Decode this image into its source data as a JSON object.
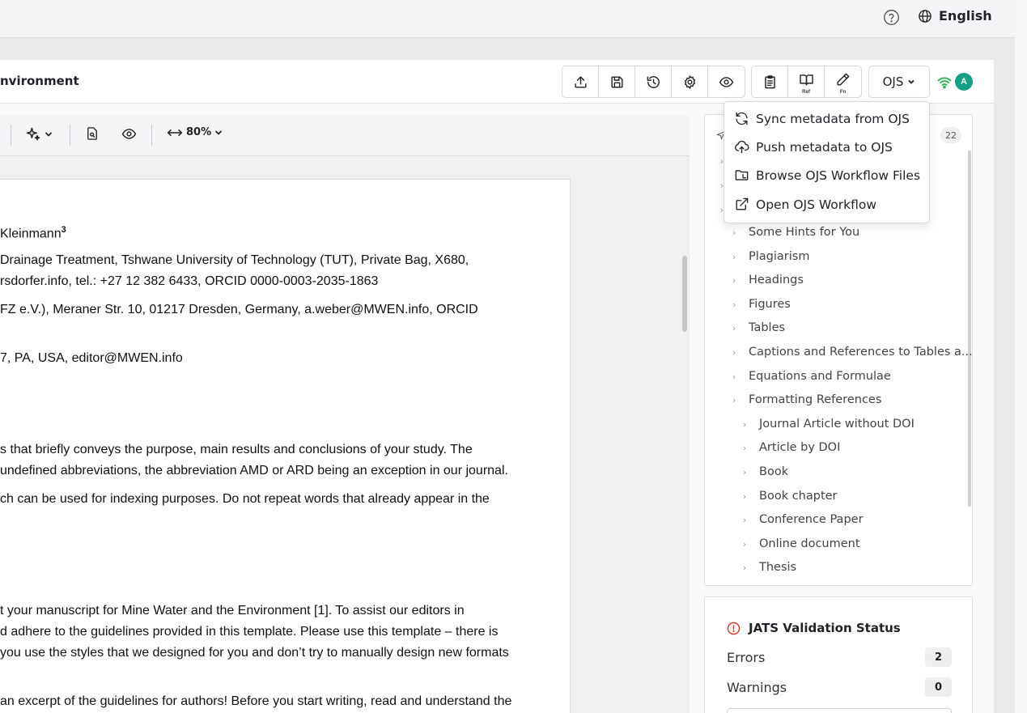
{
  "topbar": {
    "help_icon": "question-circle-icon",
    "language": "English"
  },
  "header": {
    "doc_title": "nvironment",
    "toolbar_groups": [
      [
        "upload-icon",
        "save-icon",
        "history-icon",
        "settings-icon",
        "preview-eye-icon"
      ],
      [
        "clipboard-icon",
        "references-book-icon",
        "footnote-pen-icon"
      ]
    ],
    "ref_label": "Ref",
    "fn_label": "Fn",
    "ojs_label": "OJS",
    "avatar_initial": "A",
    "accent_color": "#14a085"
  },
  "editor_toolbar": {
    "zoom": "80%"
  },
  "document": {
    "lines": [
      "Kleinmann",
      "Drainage Treatment, Tshwane University of Technology (TUT), Private Bag, X680,",
      "rsdorfer.info, tel.: +27 12 382 6433, ORCID 0000-0003-2035-1863",
      "FZ e.V.), Meraner Str. 10, 01217 Dresden, Germany, a.weber@MWEN.info, ORCID",
      "7, PA, USA, editor@MWEN.info",
      "s that briefly conveys the purpose, main results and conclusions of your study. The",
      "undefined abbreviations, the abbreviation AMD or ARD being an exception in our journal.",
      "ch can be used for indexing purposes. Do not repeat words that already appear in the",
      "t your manuscript for Mine Water and the Environment [1]. To assist our editors in",
      "d adhere to the guidelines provided in this template. Please use this template – there is",
      "you use the styles that we designed for you and don’t try to manually design new formats",
      "an excerpt of the guidelines for authors! Before you start writing, read and understand the"
    ],
    "superscript": "3"
  },
  "ojs_menu": {
    "items": [
      {
        "label": "Sync metadata from OJS",
        "icon": "sync-icon"
      },
      {
        "label": "Push metadata to OJS",
        "icon": "cloud-upload-icon"
      },
      {
        "label": "Browse OJS Workflow Files",
        "icon": "folder-icon"
      },
      {
        "label": "Open OJS Workflow",
        "icon": "external-link-icon"
      }
    ]
  },
  "outline": {
    "count": "22",
    "items": [
      {
        "label": "Some Hints for You",
        "level": 1
      },
      {
        "label": "Plagiarism",
        "level": 1
      },
      {
        "label": "Headings",
        "level": 1
      },
      {
        "label": "Figures",
        "level": 1
      },
      {
        "label": "Tables",
        "level": 1
      },
      {
        "label": "Captions and References to Tables a...",
        "level": 1
      },
      {
        "label": "Equations and Formulae",
        "level": 1
      },
      {
        "label": "Formatting References",
        "level": 1
      },
      {
        "label": "Journal Article without DOI",
        "level": 2
      },
      {
        "label": "Article by DOI",
        "level": 2
      },
      {
        "label": "Book",
        "level": 2
      },
      {
        "label": "Book chapter",
        "level": 2
      },
      {
        "label": "Conference Paper",
        "level": 2
      },
      {
        "label": "Online document",
        "level": 2
      },
      {
        "label": "Thesis",
        "level": 2
      }
    ]
  },
  "jats": {
    "title": "JATS Validation Status",
    "errors_label": "Errors",
    "errors_count": "2",
    "warnings_label": "Warnings",
    "warnings_count": "0",
    "error_color": "#d93025"
  }
}
